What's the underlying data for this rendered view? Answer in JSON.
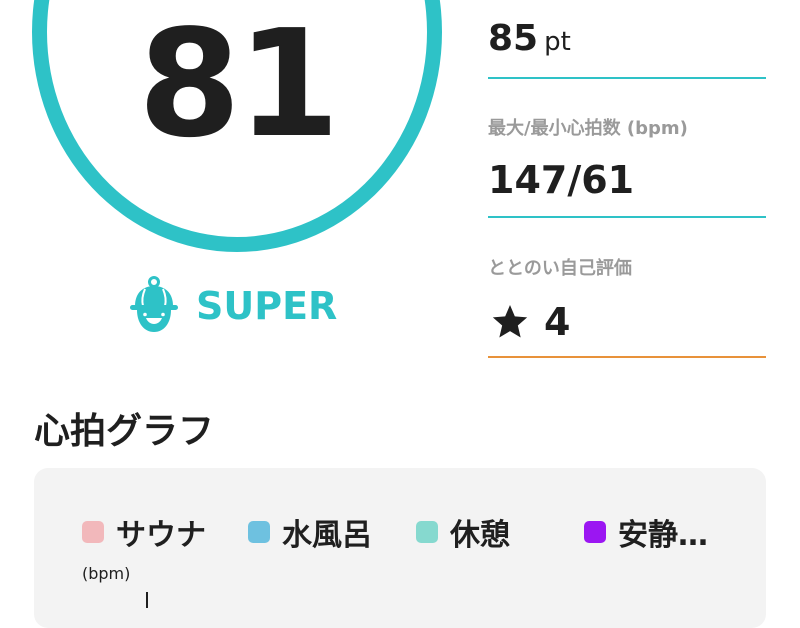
{
  "score": {
    "value": "81",
    "level": "SUPER",
    "level_icon": "sauna-hat-icon",
    "ring_color": "#2ec2c7"
  },
  "stats": {
    "points": {
      "value": "85",
      "unit": "pt"
    },
    "heart_rate": {
      "label": "最大/最小心拍数 (bpm)",
      "value": "147/61"
    },
    "rating": {
      "label": "ととのい自己評価",
      "value": "4",
      "icon": "star-icon"
    }
  },
  "graph": {
    "title": "心拍グラフ",
    "y_unit": "(bpm)",
    "legend": [
      {
        "label": "サウナ",
        "color": "#f2b8bb"
      },
      {
        "label": "水風呂",
        "color": "#6ec1e0"
      },
      {
        "label": "休憩",
        "color": "#86d9cf"
      },
      {
        "label": "安静…",
        "color": "#9b16f2"
      }
    ]
  },
  "colors": {
    "accent": "#2ec2c7",
    "rating_underline": "#e8923a",
    "card_background": "#f3f3f3"
  }
}
